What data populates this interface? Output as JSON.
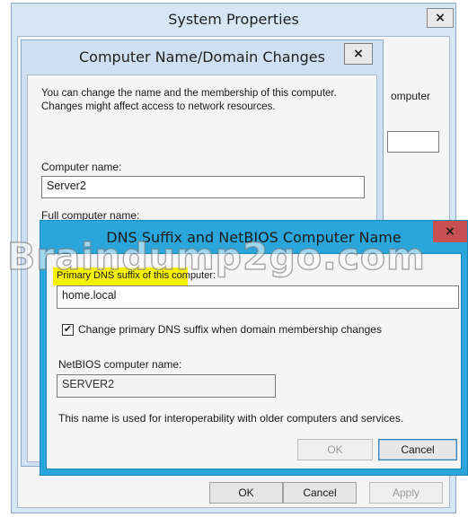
{
  "system_properties": {
    "title": "System Properties",
    "close": "×",
    "partial_label": "omputer",
    "ok_label": "OK",
    "cancel_label": "Cancel",
    "apply_label": "Apply"
  },
  "computer_name_dialog": {
    "title": "Computer Name/Domain Changes",
    "close": "×",
    "description": "You can change the name and the membership of this computer. Changes might affect access to network resources.",
    "computer_name_label": "Computer name:",
    "computer_name_value": "Server2",
    "full_computer_name_label": "Full computer name:"
  },
  "dns_suffix_dialog": {
    "title": "DNS Suffix and NetBIOS Computer Name",
    "close": "×",
    "primary_dns_label": "Primary DNS suffix of this computer:",
    "primary_dns_value": "home.local",
    "change_checkbox_label": "Change primary DNS suffix when domain membership changes",
    "change_checkbox_checked": true,
    "netbios_label": "NetBIOS computer name:",
    "netbios_value": "SERVER2",
    "info_text": "This name is used for interoperability with older computers and services.",
    "ok_label": "OK",
    "cancel_label": "Cancel"
  },
  "watermark": {
    "text": "Braindump2go.com"
  },
  "colors": {
    "highlight": "#f4f000",
    "dns_frame": "#2aa6dc",
    "close_red": "#c75050"
  }
}
